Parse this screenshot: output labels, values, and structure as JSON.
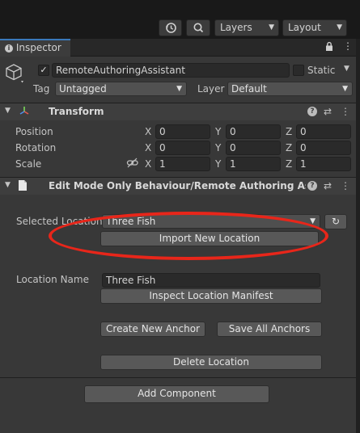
{
  "toolbar": {
    "history_icon": "history-icon",
    "search_icon": "search-icon",
    "layers_label": "Layers",
    "layout_label": "Layout"
  },
  "tab": {
    "label": "Inspector"
  },
  "header": {
    "object_name": "RemoteAuthoringAssistant",
    "static_label": "Static",
    "tag_label": "Tag",
    "tag_value": "Untagged",
    "layer_label": "Layer",
    "layer_value": "Default"
  },
  "transform": {
    "title": "Transform",
    "rows": [
      {
        "label": "Position",
        "x": "0",
        "y": "0",
        "z": "0"
      },
      {
        "label": "Rotation",
        "x": "0",
        "y": "0",
        "z": "0"
      },
      {
        "label": "Scale",
        "x": "1",
        "y": "1",
        "z": "1"
      }
    ],
    "axis_x": "X",
    "axis_y": "Y",
    "axis_z": "Z"
  },
  "behaviour": {
    "title": "Edit Mode Only Behaviour/Remote Authoring Assistan",
    "selected_location_label": "Selected Location",
    "selected_location_value": "Three Fish",
    "import_button": "Import New Location",
    "location_name_label": "Location Name",
    "location_name_value": "Three Fish",
    "inspect_button": "Inspect Location Manifest",
    "create_anchor_button": "Create New Anchor",
    "save_anchors_button": "Save All Anchors",
    "delete_button": "Delete Location"
  },
  "add_component_label": "Add Component",
  "colors": {
    "accent": "#3a79bb",
    "highlight": "#e8261a",
    "background": "#383838"
  }
}
